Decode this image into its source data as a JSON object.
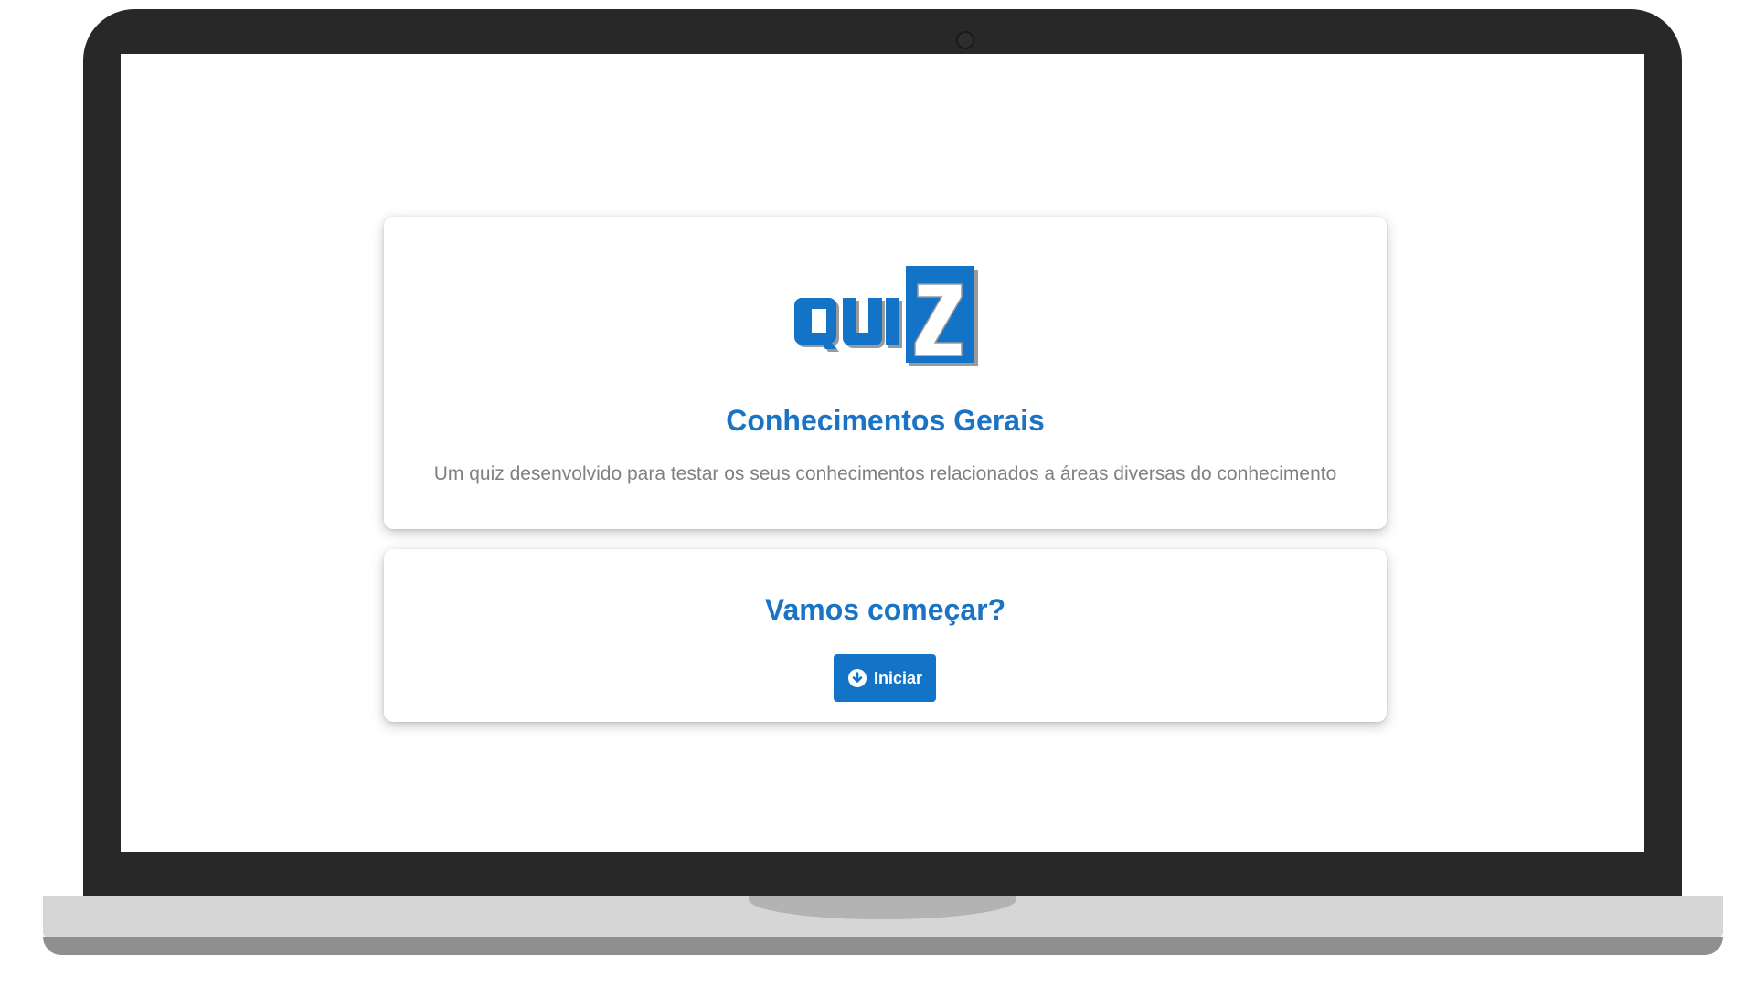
{
  "logo": {
    "text": "QUIZ",
    "colors": {
      "primary": "#1273c7",
      "shadow": "#9a9a9a",
      "light": "#ffffff"
    }
  },
  "intro": {
    "title": "Conhecimentos Gerais",
    "description": "Um quiz desenvolvido para testar os seus conhecimentos relacionados a áreas diversas do conhecimento"
  },
  "start": {
    "question": "Vamos começar?",
    "button_label": "Iniciar",
    "button_icon": "arrow-circle-down-icon"
  },
  "colors": {
    "accent": "#1a73c4",
    "button": "#1273c7",
    "text_muted": "#808080",
    "bezel": "#282828"
  }
}
